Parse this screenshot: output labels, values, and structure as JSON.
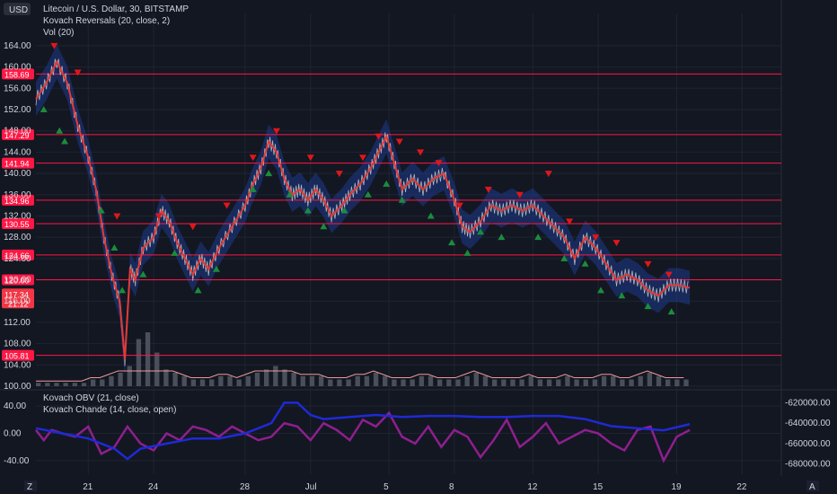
{
  "header": {
    "currency": "USD",
    "title": "Litecoin / U.S. Dollar, 30, BITSTAMP",
    "indicator1": "Kovach Reversals (20, close, 2)",
    "indicator2": "Vol (20)",
    "sub_indicator1": "Kovach OBV (21, close)",
    "sub_indicator2": "Kovach Chande (14, close, open)"
  },
  "footer": {
    "left_icon_letter": "Z",
    "right_icon_letter": "A"
  },
  "colors": {
    "background": "#131722",
    "grid": "#1f2433",
    "price_line": "#b2b5be",
    "mean_line": "#e53935",
    "band": "#1e3a8a",
    "level_line": "#ff1744",
    "up_marker": "#1b8c3c",
    "down_marker": "#e0161b",
    "volume": "#4a4f5c",
    "volume_ma": "#ef9a9a",
    "obv": "#1f2ad6",
    "chande": "#8e1f8e",
    "current_price_tag": "#f23645"
  },
  "chart_data": [
    {
      "type": "line",
      "name": "main-price",
      "y_axis_ticks": [
        "164.00",
        "160.00",
        "156.00",
        "152.00",
        "148.00",
        "144.00",
        "140.00",
        "136.00",
        "132.00",
        "128.00",
        "124.00",
        "120.00",
        "116.00",
        "112.00",
        "108.00",
        "104.00",
        "100.00"
      ],
      "ylim": [
        100,
        165
      ],
      "x_tick_labels": [
        "21",
        "24",
        "28",
        "Jul",
        "5",
        "8",
        "12",
        "15",
        "19",
        "22"
      ],
      "x_tick_positions": [
        2,
        4.5,
        8,
        10.5,
        13.5,
        16,
        19,
        21.5,
        24.5,
        27
      ],
      "xlim": [
        0,
        28.5
      ],
      "price_series": [
        [
          0,
          154
        ],
        [
          0.4,
          157
        ],
        [
          0.8,
          161
        ],
        [
          1.2,
          157
        ],
        [
          1.6,
          149
        ],
        [
          2.0,
          143
        ],
        [
          2.3,
          137
        ],
        [
          2.6,
          128
        ],
        [
          2.9,
          121
        ],
        [
          3.2,
          116
        ],
        [
          3.4,
          105
        ],
        [
          3.6,
          122
        ],
        [
          3.8,
          120
        ],
        [
          4.1,
          126
        ],
        [
          4.5,
          128
        ],
        [
          4.8,
          133
        ],
        [
          5.1,
          131
        ],
        [
          5.4,
          127
        ],
        [
          5.7,
          124
        ],
        [
          6.0,
          121
        ],
        [
          6.3,
          124
        ],
        [
          6.6,
          122
        ],
        [
          7.0,
          126
        ],
        [
          7.5,
          130
        ],
        [
          8.0,
          134
        ],
        [
          8.3,
          138
        ],
        [
          8.6,
          141
        ],
        [
          8.9,
          146
        ],
        [
          9.2,
          144
        ],
        [
          9.5,
          139
        ],
        [
          9.8,
          136
        ],
        [
          10.1,
          137
        ],
        [
          10.4,
          135
        ],
        [
          10.7,
          137
        ],
        [
          11.0,
          135
        ],
        [
          11.3,
          132
        ],
        [
          11.7,
          134
        ],
        [
          12.0,
          136
        ],
        [
          12.4,
          138
        ],
        [
          12.8,
          141
        ],
        [
          13.1,
          144
        ],
        [
          13.4,
          147
        ],
        [
          13.7,
          142
        ],
        [
          14.0,
          137
        ],
        [
          14.4,
          139
        ],
        [
          14.8,
          137
        ],
        [
          15.2,
          139
        ],
        [
          15.6,
          140
        ],
        [
          16.0,
          135
        ],
        [
          16.3,
          130
        ],
        [
          16.6,
          129
        ],
        [
          17.0,
          131
        ],
        [
          17.4,
          134
        ],
        [
          17.8,
          133
        ],
        [
          18.2,
          134
        ],
        [
          18.6,
          133
        ],
        [
          19.0,
          134
        ],
        [
          19.4,
          132
        ],
        [
          19.8,
          130
        ],
        [
          20.2,
          128
        ],
        [
          20.6,
          124
        ],
        [
          21.0,
          128
        ],
        [
          21.4,
          126
        ],
        [
          21.8,
          123
        ],
        [
          22.2,
          120
        ],
        [
          22.6,
          121
        ],
        [
          23.0,
          120
        ],
        [
          23.4,
          118
        ],
        [
          23.8,
          117
        ],
        [
          24.2,
          119
        ],
        [
          24.6,
          119
        ],
        [
          25.0,
          118.5
        ]
      ],
      "level_lines": [
        {
          "label": "158.69",
          "value": 158.69
        },
        {
          "label": "147.29",
          "value": 147.29
        },
        {
          "label": "141.94",
          "value": 141.94
        },
        {
          "label": "134.96",
          "value": 134.96
        },
        {
          "label": "130.55",
          "value": 130.55
        },
        {
          "label": "124.66",
          "value": 124.66
        },
        {
          "label": "120.00",
          "value": 120.0
        },
        {
          "label": "105.81",
          "value": 105.81
        }
      ],
      "current_price": {
        "label": "117.34",
        "time": "21:12",
        "value": 117.34
      },
      "up_markers": [
        [
          0.3,
          152
        ],
        [
          0.9,
          148
        ],
        [
          1.1,
          146
        ],
        [
          2.5,
          133
        ],
        [
          3.0,
          126
        ],
        [
          3.3,
          118
        ],
        [
          4.1,
          121
        ],
        [
          5.3,
          125
        ],
        [
          6.2,
          118
        ],
        [
          6.9,
          122
        ],
        [
          8.3,
          137
        ],
        [
          8.9,
          140
        ],
        [
          9.7,
          136
        ],
        [
          10.4,
          133
        ],
        [
          11.0,
          130
        ],
        [
          11.8,
          133
        ],
        [
          12.7,
          136
        ],
        [
          13.4,
          138
        ],
        [
          14.0,
          135
        ],
        [
          15.1,
          132
        ],
        [
          15.9,
          127
        ],
        [
          16.5,
          125
        ],
        [
          17.0,
          129
        ],
        [
          17.8,
          128
        ],
        [
          19.2,
          128
        ],
        [
          20.2,
          124
        ],
        [
          21.0,
          123
        ],
        [
          21.6,
          118
        ],
        [
          22.4,
          117
        ],
        [
          23.4,
          115
        ],
        [
          24.3,
          114
        ]
      ],
      "down_markers": [
        [
          0.7,
          164
        ],
        [
          1.6,
          159
        ],
        [
          3.1,
          132
        ],
        [
          4.7,
          132
        ],
        [
          6.0,
          130
        ],
        [
          7.3,
          134
        ],
        [
          8.3,
          143
        ],
        [
          9.2,
          148
        ],
        [
          10.5,
          143
        ],
        [
          11.6,
          140
        ],
        [
          12.5,
          143
        ],
        [
          13.1,
          147
        ],
        [
          13.9,
          146
        ],
        [
          14.7,
          144
        ],
        [
          15.4,
          142
        ],
        [
          16.2,
          134
        ],
        [
          17.3,
          137
        ],
        [
          18.5,
          136
        ],
        [
          19.6,
          140
        ],
        [
          20.4,
          131
        ],
        [
          21.4,
          128
        ],
        [
          22.2,
          127
        ],
        [
          23.4,
          123
        ],
        [
          24.2,
          121
        ]
      ],
      "volume": [
        1,
        1,
        1,
        1,
        1,
        1,
        2,
        2,
        3,
        4,
        6,
        14,
        16,
        10,
        5,
        4,
        3,
        2,
        2,
        2,
        3,
        3,
        2,
        3,
        4,
        5,
        6,
        5,
        4,
        3,
        3,
        3,
        2,
        2,
        2,
        3,
        3,
        4,
        3,
        2,
        2,
        2,
        3,
        3,
        2,
        2,
        2,
        3,
        4,
        3,
        2,
        2,
        2,
        2,
        3,
        2,
        2,
        2,
        3,
        2,
        2,
        2,
        3,
        3,
        2,
        2,
        3,
        4,
        3,
        2,
        2,
        2
      ]
    },
    {
      "type": "line",
      "name": "kovach-indicators",
      "left_axis_ticks": [
        "40.00",
        "0.00",
        "-40.00"
      ],
      "right_axis_ticks": [
        "-620000.00",
        "-640000.00",
        "-660000.00",
        "-680000.00"
      ],
      "ylim_left": [
        -60,
        60
      ],
      "ylim_right": [
        -690000,
        -610000
      ],
      "obv_series": [
        [
          0,
          -645000
        ],
        [
          1,
          -650000
        ],
        [
          2,
          -655000
        ],
        [
          3,
          -665000
        ],
        [
          3.5,
          -675000
        ],
        [
          4,
          -665000
        ],
        [
          5,
          -660000
        ],
        [
          6,
          -655000
        ],
        [
          7,
          -655000
        ],
        [
          8,
          -650000
        ],
        [
          9,
          -640000
        ],
        [
          9.5,
          -620000
        ],
        [
          10,
          -620000
        ],
        [
          10.5,
          -632000
        ],
        [
          11,
          -636000
        ],
        [
          12,
          -634000
        ],
        [
          13,
          -632000
        ],
        [
          14,
          -634000
        ],
        [
          15,
          -633000
        ],
        [
          16,
          -633000
        ],
        [
          17,
          -634000
        ],
        [
          18,
          -634000
        ],
        [
          19,
          -633000
        ],
        [
          20,
          -633000
        ],
        [
          21,
          -636000
        ],
        [
          22,
          -643000
        ],
        [
          23,
          -645000
        ],
        [
          24,
          -647000
        ],
        [
          25,
          -641000
        ]
      ],
      "chande_series": [
        [
          0,
          5
        ],
        [
          0.3,
          -10
        ],
        [
          0.6,
          5
        ],
        [
          1,
          0
        ],
        [
          1.5,
          -5
        ],
        [
          2,
          10
        ],
        [
          2.5,
          -30
        ],
        [
          3,
          -20
        ],
        [
          3.5,
          10
        ],
        [
          4,
          -15
        ],
        [
          4.5,
          -25
        ],
        [
          5,
          0
        ],
        [
          5.5,
          -10
        ],
        [
          6,
          10
        ],
        [
          6.5,
          5
        ],
        [
          7,
          -5
        ],
        [
          7.5,
          10
        ],
        [
          8,
          0
        ],
        [
          8.5,
          -10
        ],
        [
          9,
          -5
        ],
        [
          9.5,
          15
        ],
        [
          10,
          10
        ],
        [
          10.5,
          -10
        ],
        [
          11,
          15
        ],
        [
          11.5,
          5
        ],
        [
          12,
          -10
        ],
        [
          12.5,
          20
        ],
        [
          13,
          10
        ],
        [
          13.5,
          30
        ],
        [
          14,
          -5
        ],
        [
          14.5,
          -15
        ],
        [
          15,
          10
        ],
        [
          15.5,
          -20
        ],
        [
          16,
          5
        ],
        [
          16.5,
          -5
        ],
        [
          17,
          -35
        ],
        [
          17.5,
          -10
        ],
        [
          18,
          20
        ],
        [
          18.5,
          -20
        ],
        [
          19,
          -5
        ],
        [
          19.5,
          15
        ],
        [
          20,
          -15
        ],
        [
          20.5,
          -5
        ],
        [
          21,
          5
        ],
        [
          21.5,
          0
        ],
        [
          22,
          -15
        ],
        [
          22.5,
          -25
        ],
        [
          23,
          5
        ],
        [
          23.5,
          10
        ],
        [
          24,
          -40
        ],
        [
          24.5,
          -5
        ],
        [
          25,
          5
        ]
      ]
    }
  ]
}
